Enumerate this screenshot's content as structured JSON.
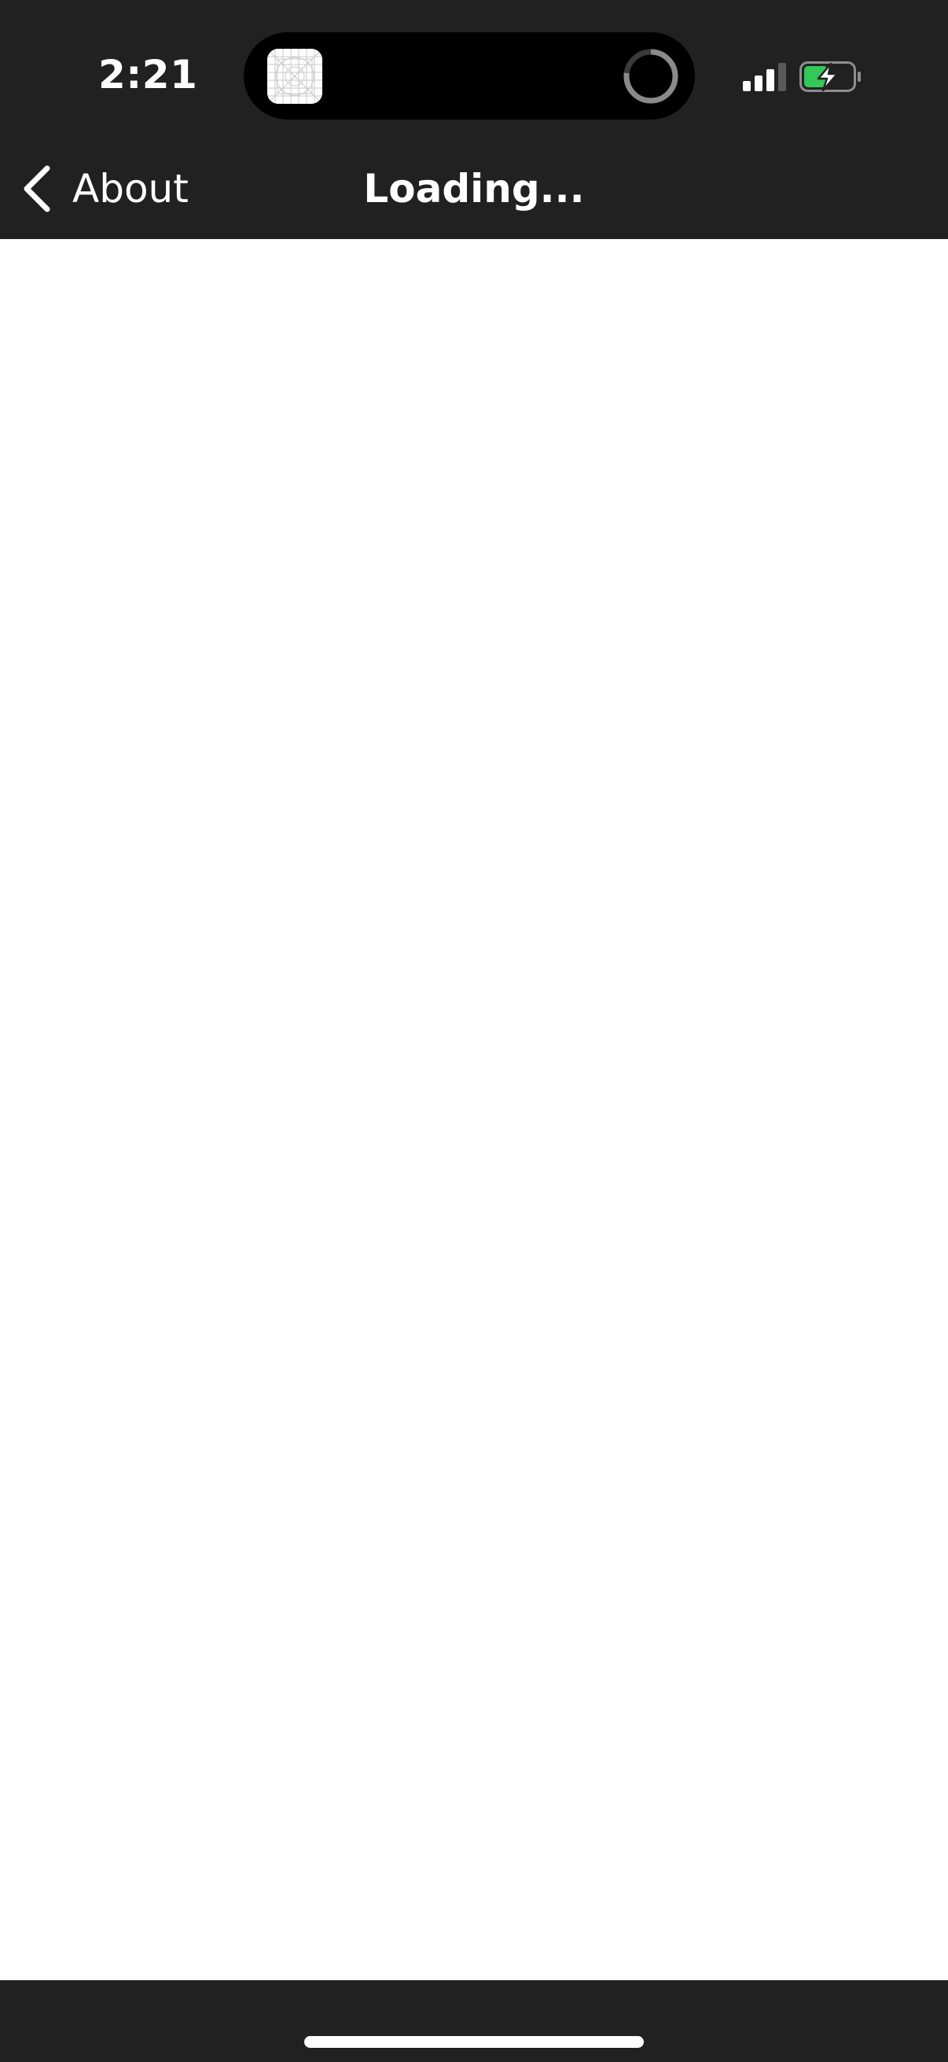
{
  "status_bar": {
    "time": "2:21",
    "signal_icon": "cellular-signal-icon",
    "battery_icon": "battery-charging-icon",
    "battery_color": "#34c759"
  },
  "dynamic_island": {
    "app_icon": "app-placeholder-icon",
    "activity_icon": "progress-ring-icon"
  },
  "nav": {
    "back_label": "About",
    "title": "Loading...",
    "background": "#212121"
  },
  "home_indicator": {
    "color": "#ffffff"
  }
}
